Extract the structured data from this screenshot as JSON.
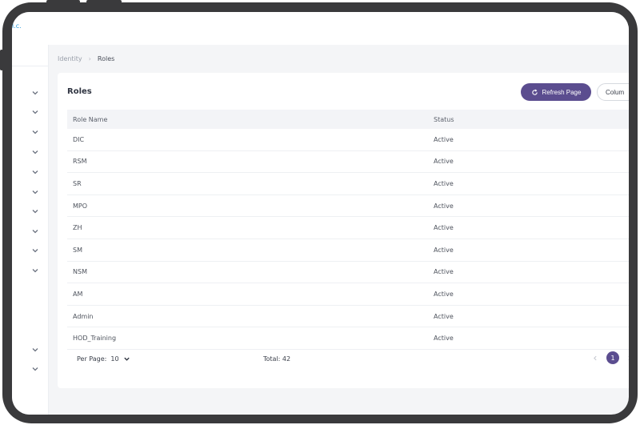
{
  "topbar": {
    "brand_fragment": "l.c."
  },
  "breadcrumb": {
    "parent": "Identity",
    "separator": "›",
    "current": "Roles"
  },
  "card": {
    "title": "Roles",
    "refresh_label": "Refresh Page",
    "columns_label": "Colum"
  },
  "table": {
    "headers": {
      "name": "Role Name",
      "status": "Status"
    },
    "rows": [
      {
        "name": "DIC",
        "status": "Active"
      },
      {
        "name": "RSM",
        "status": "Active"
      },
      {
        "name": "SR",
        "status": "Active"
      },
      {
        "name": "MPO",
        "status": "Active"
      },
      {
        "name": "ZH",
        "status": "Active"
      },
      {
        "name": "SM",
        "status": "Active"
      },
      {
        "name": "NSM",
        "status": "Active"
      },
      {
        "name": "AM",
        "status": "Active"
      },
      {
        "name": "Admin",
        "status": "Active"
      },
      {
        "name": "HOD_Training",
        "status": "Active"
      }
    ]
  },
  "footer": {
    "per_page_label": "Per Page:",
    "per_page_value": "10",
    "total_label": "Total: 42",
    "current_page": "1"
  },
  "colors": {
    "accent": "#5b4d8f",
    "brand": "#2d9cdb"
  }
}
